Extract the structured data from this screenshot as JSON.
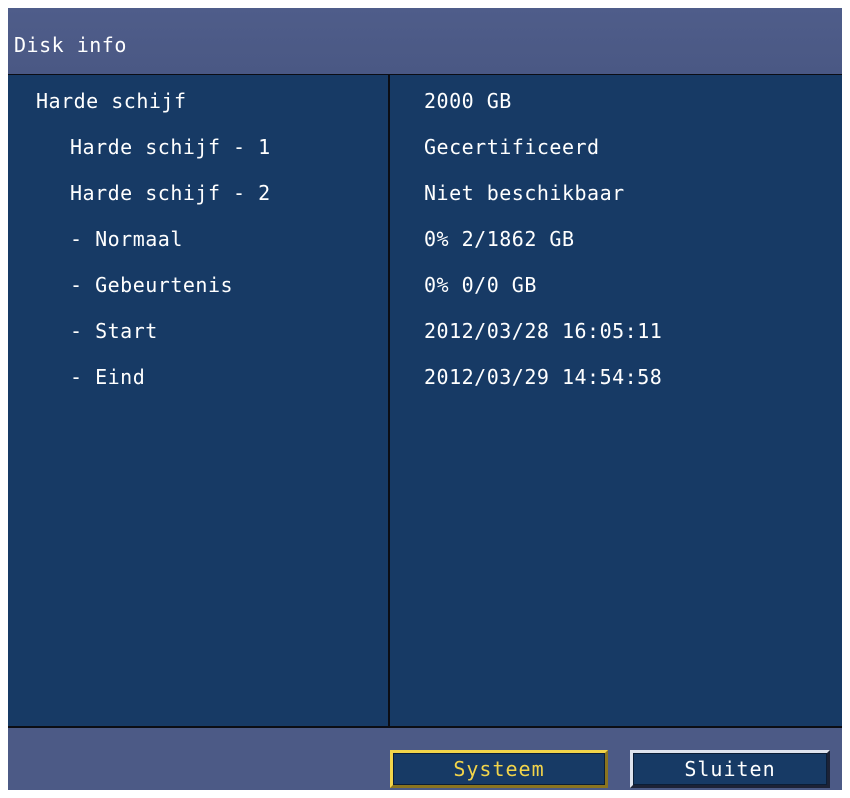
{
  "window": {
    "title": "Disk info"
  },
  "rows": [
    {
      "label": "Harde schijf",
      "value": "2000 GB"
    },
    {
      "label": "Harde schijf - 1",
      "value": "Gecertificeerd"
    },
    {
      "label": "Harde schijf - 2",
      "value": "Niet beschikbaar"
    },
    {
      "label": "- Normaal",
      "value": "0% 2/1862 GB"
    },
    {
      "label": "- Gebeurtenis",
      "value": "0% 0/0 GB"
    },
    {
      "label": "- Start",
      "value": "2012/03/28 16:05:11"
    },
    {
      "label": "- Eind",
      "value": "2012/03/29 14:54:58"
    }
  ],
  "buttons": {
    "systeem": "Systeem",
    "sluiten": "Sluiten"
  },
  "colors": {
    "window_bg": "#4c5a86",
    "panel_bg": "#173a65",
    "focus_accent": "#f2d44a",
    "text": "#ffffff"
  }
}
